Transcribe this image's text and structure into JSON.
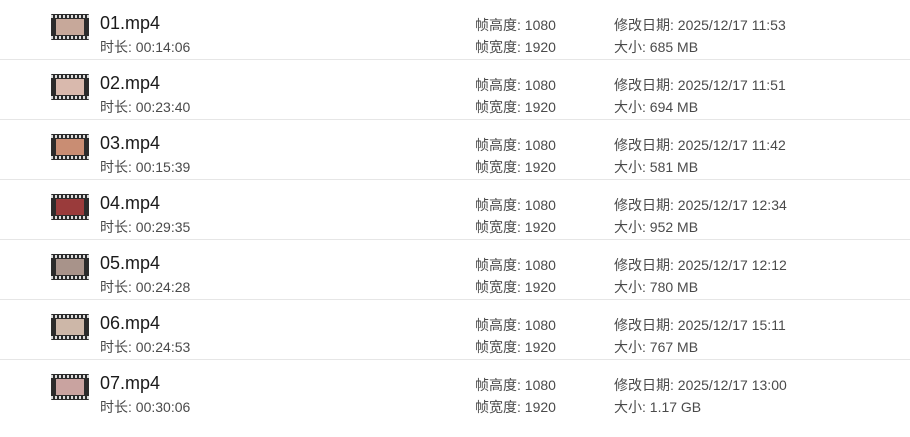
{
  "files": [
    {
      "name": "01.mp4",
      "duration": "时长: 00:14:06",
      "frame_height": "帧高度: 1080",
      "frame_width": "帧宽度: 1920",
      "modified": "修改日期: 2025/12/17 11:53",
      "size": "大小: 685 MB",
      "thumb_color": "#c7a89a"
    },
    {
      "name": "02.mp4",
      "duration": "时长: 00:23:40",
      "frame_height": "帧高度: 1080",
      "frame_width": "帧宽度: 1920",
      "modified": "修改日期: 2025/12/17 11:51",
      "size": "大小: 694 MB",
      "thumb_color": "#d9b9ad"
    },
    {
      "name": "03.mp4",
      "duration": "时长: 00:15:39",
      "frame_height": "帧高度: 1080",
      "frame_width": "帧宽度: 1920",
      "modified": "修改日期: 2025/12/17 11:42",
      "size": "大小: 581 MB",
      "thumb_color": "#c98d73"
    },
    {
      "name": "04.mp4",
      "duration": "时长: 00:29:35",
      "frame_height": "帧高度: 1080",
      "frame_width": "帧宽度: 1920",
      "modified": "修改日期: 2025/12/17 12:34",
      "size": "大小: 952 MB",
      "thumb_color": "#9a3b3b"
    },
    {
      "name": "05.mp4",
      "duration": "时长: 00:24:28",
      "frame_height": "帧高度: 1080",
      "frame_width": "帧宽度: 1920",
      "modified": "修改日期: 2025/12/17 12:12",
      "size": "大小: 780 MB",
      "thumb_color": "#a8938a"
    },
    {
      "name": "06.mp4",
      "duration": "时长: 00:24:53",
      "frame_height": "帧高度: 1080",
      "frame_width": "帧宽度: 1920",
      "modified": "修改日期: 2025/12/17 15:11",
      "size": "大小: 767 MB",
      "thumb_color": "#cdb7a8"
    },
    {
      "name": "07.mp4",
      "duration": "时长: 00:30:06",
      "frame_height": "帧高度: 1080",
      "frame_width": "帧宽度: 1920",
      "modified": "修改日期: 2025/12/17 13:00",
      "size": "大小: 1.17 GB",
      "thumb_color": "#c9a3a0"
    }
  ]
}
